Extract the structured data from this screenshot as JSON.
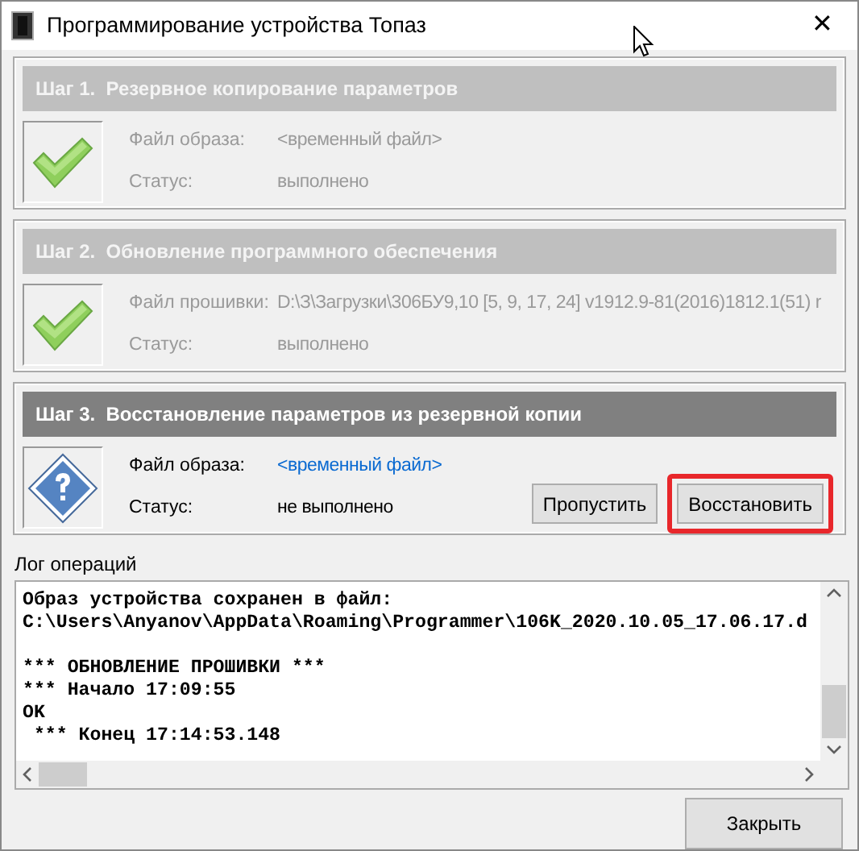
{
  "window": {
    "title": "Программирование устройства Топаз",
    "close": "✕"
  },
  "steps": [
    {
      "title": "Шаг 1.  Резервное копирование параметров",
      "kind": "check",
      "active": false,
      "fields": [
        {
          "label": "Файл образа:",
          "value": "<временный файл>",
          "link": true
        },
        {
          "label": "Статус:",
          "value": "выполнено",
          "link": false
        }
      ]
    },
    {
      "title": "Шаг 2.  Обновление программного обеспечения",
      "kind": "check",
      "active": false,
      "fields": [
        {
          "label": "Файл прошивки:",
          "value": "D:\\З\\Загрузки\\306БУ9,10 [5, 9, 17, 24] v1912.9-81(2016)1812.1(51) r",
          "link": false
        },
        {
          "label": "Статус:",
          "value": "выполнено",
          "link": false
        }
      ]
    },
    {
      "title": "Шаг 3.  Восстановление параметров из резервной копии",
      "kind": "question",
      "active": true,
      "fields": [
        {
          "label": "Файл образа:",
          "value": "<временный файл>",
          "link": true
        },
        {
          "label": "Статус:",
          "value": "не выполнено",
          "link": false
        }
      ],
      "buttons": [
        {
          "label": "Пропустить",
          "highlighted": false
        },
        {
          "label": "Восстановить",
          "highlighted": true
        }
      ]
    }
  ],
  "log": {
    "label": "Лог операций",
    "paragraphs": [
      [
        "Образ устройства сохранен в файл:",
        "C:\\Users\\Anyanov\\AppData\\Roaming\\Programmer\\106K_2020.10.05_17.06.17.d"
      ],
      [
        "*** ОБНОВЛЕНИЕ ПРОШИВКИ ***",
        "*** Начало 17:09:55",
        "OK",
        " *** Конец 17:14:53.148"
      ]
    ]
  },
  "buttons": [
    "Закрыть"
  ]
}
